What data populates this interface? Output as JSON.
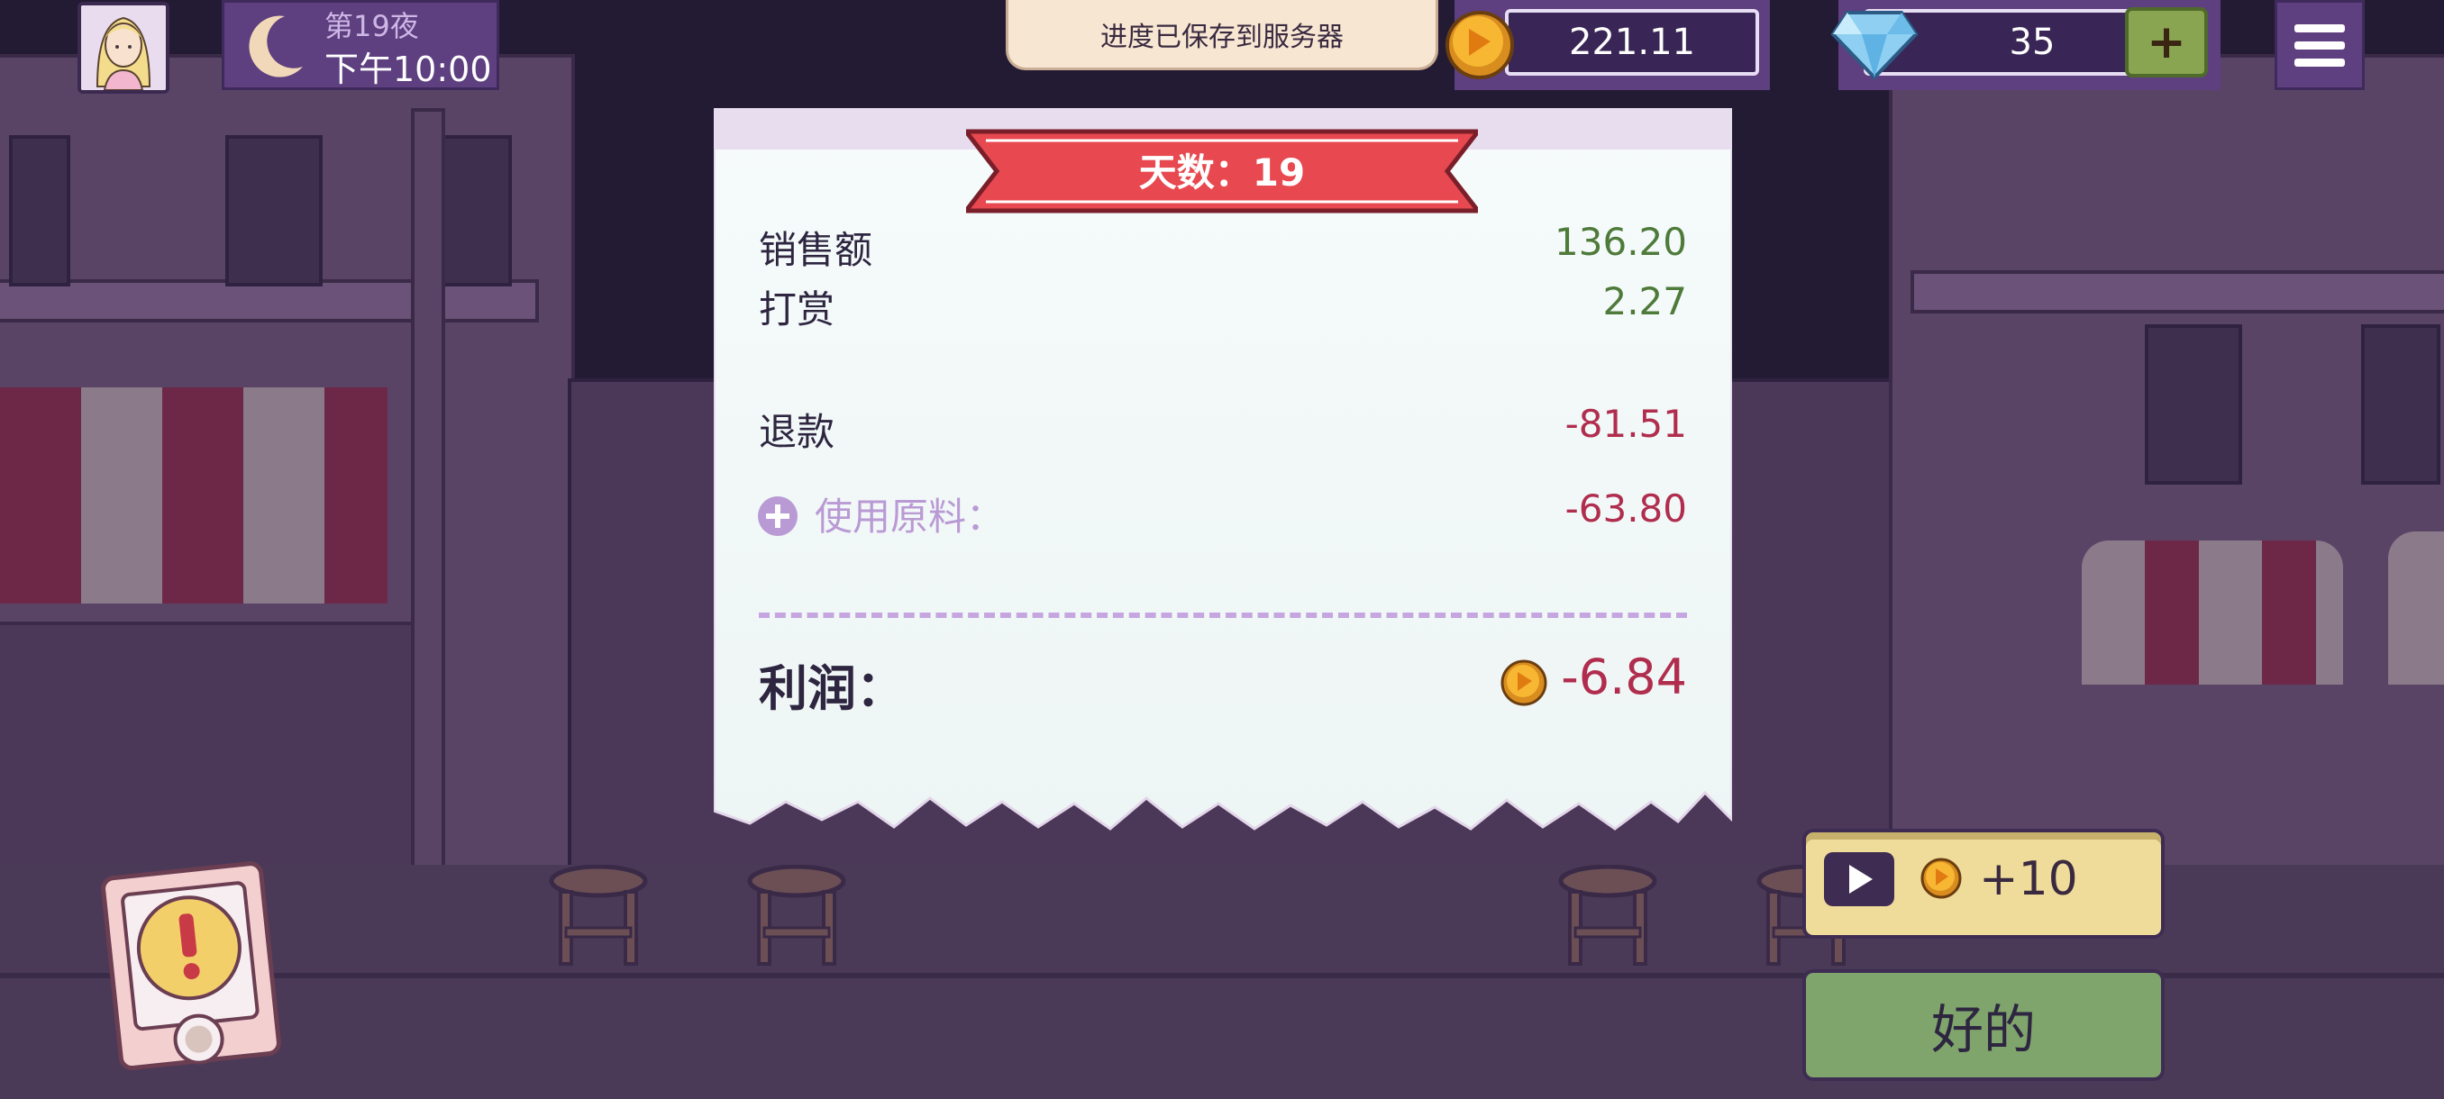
{
  "top_bar": {
    "day_label": "第19夜",
    "time_label": "下午10:00",
    "save_toast": "进度已保存到服务器",
    "coins": "221.11",
    "gems": "35",
    "gem_add_label": "+"
  },
  "receipt": {
    "title": "天数：19",
    "rows": [
      {
        "label": "销售额",
        "value": "136.20",
        "tone": "positive"
      },
      {
        "label": "打赏",
        "value": "2.27",
        "tone": "positive"
      },
      {
        "label": "退款",
        "value": "-81.51",
        "tone": "negative"
      },
      {
        "label": "使用原料：",
        "value": "-63.80",
        "tone": "negative"
      }
    ],
    "profit_label": "利润：",
    "profit_value": "-6.84"
  },
  "buttons": {
    "ad_reward": "+10",
    "ok": "好的"
  },
  "colors": {
    "positive": "#4e7a3a",
    "negative": "#b02d4e",
    "ribbon": "#e8484f",
    "panel": "#5e3f7f"
  },
  "icons": [
    "player-avatar",
    "moon-icon",
    "coin-icon",
    "gem-icon",
    "plus-icon",
    "menu-icon",
    "expand-icon",
    "play-icon",
    "alert-icon"
  ]
}
